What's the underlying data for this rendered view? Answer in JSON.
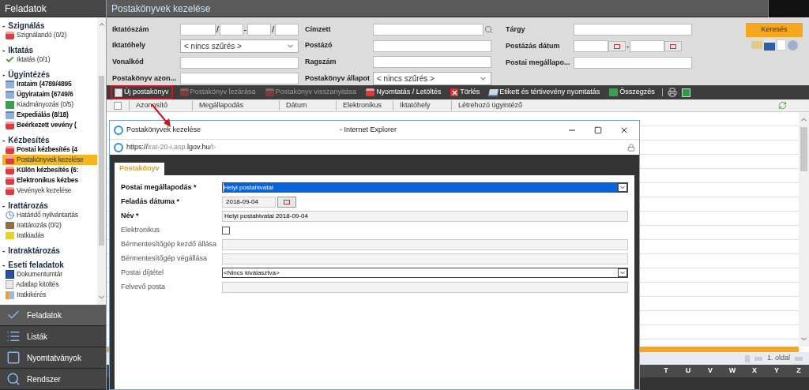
{
  "sidebar": {
    "title": "Feladatok",
    "sections": [
      {
        "toggle": "-",
        "title": "Szignálás",
        "items": [
          {
            "label": "Szignálandó (0/2)",
            "kind": "red",
            "bold": false,
            "selected": false
          }
        ]
      },
      {
        "toggle": "-",
        "title": "Iktatás",
        "items": [
          {
            "label": "Iktatás (0/1)",
            "kind": "check",
            "bold": false,
            "selected": false
          }
        ]
      },
      {
        "toggle": "-",
        "title": "Ügyintézés",
        "items": [
          {
            "label": "Irataim (4789/4895",
            "kind": "blue",
            "bold": true,
            "selected": false
          },
          {
            "label": "Ügyirataim (6749/6",
            "kind": "blue",
            "bold": true,
            "selected": false
          },
          {
            "label": "Kiadmányozás (0/5)",
            "kind": "green",
            "bold": false,
            "selected": false
          },
          {
            "label": "Expediálás (8/18)",
            "kind": "blue",
            "bold": true,
            "selected": false
          },
          {
            "label": "Beérkezett vevény (",
            "kind": "red",
            "bold": true,
            "selected": false
          }
        ]
      },
      {
        "toggle": "-",
        "title": "Kézbesítés",
        "items": [
          {
            "label": "Postai kézbesítés (4",
            "kind": "red",
            "bold": true,
            "selected": false
          },
          {
            "label": "Postakönyvek kezelése",
            "kind": "red",
            "bold": false,
            "selected": true
          },
          {
            "label": "Külön kézbesítés (6:",
            "kind": "red",
            "bold": true,
            "selected": false
          },
          {
            "label": "Elektronikus kézbes",
            "kind": "red",
            "bold": true,
            "selected": false
          },
          {
            "label": "Vevények kezelése",
            "kind": "red",
            "bold": false,
            "selected": false
          }
        ]
      },
      {
        "toggle": "-",
        "title": "Irattározás",
        "items": [
          {
            "label": "Határidő nyilvántartás",
            "kind": "clock",
            "bold": false,
            "selected": false
          },
          {
            "label": "Irattározás (0/2)",
            "kind": "brown",
            "bold": false,
            "selected": false
          },
          {
            "label": "Iratkiadás",
            "kind": "yellow",
            "bold": false,
            "selected": false
          }
        ]
      },
      {
        "toggle": "-",
        "title": "Iratraktározás"
      },
      {
        "toggle": "-",
        "title": "Eseti feladatok",
        "items": [
          {
            "label": "Dokumentumtár",
            "kind": "word",
            "bold": false,
            "selected": false
          },
          {
            "label": "Adatlap kitöltés",
            "kind": "doc",
            "bold": false,
            "selected": false
          },
          {
            "label": "Iratkikérés",
            "kind": "arrow",
            "bold": false,
            "selected": false
          }
        ]
      }
    ],
    "nav": [
      {
        "label": "Feladatok",
        "kind": "check",
        "selected": true
      },
      {
        "label": "Listák",
        "kind": "list",
        "selected": false
      },
      {
        "label": "Nyomtatványok",
        "kind": "form",
        "selected": false
      },
      {
        "label": "Rendszer",
        "kind": "search",
        "selected": false
      }
    ]
  },
  "header": {
    "title": "Postakönyvek kezelése"
  },
  "filters": [
    [
      {
        "label": "Iktatószám",
        "kind": "number",
        "separators": [
          "/",
          "-",
          "/"
        ]
      },
      {
        "label": "Iktatóhely",
        "kind": "select",
        "value": "< nincs szűrés >"
      },
      {
        "label": "Vonalkód",
        "kind": "text"
      },
      {
        "label": "Postakönyv azon...",
        "kind": "text"
      }
    ],
    [
      {
        "label": "Címzett",
        "kind": "lookup"
      },
      {
        "label": "Postázó",
        "kind": "text"
      },
      {
        "label": "Ragszám",
        "kind": "text"
      },
      {
        "label": "Postakönyv állapot",
        "kind": "select",
        "value": "< nincs szűrés >"
      }
    ],
    [
      {
        "label": "Tárgy",
        "kind": "text"
      },
      {
        "label": "Postázás dátum",
        "kind": "daterange",
        "separator": "-"
      },
      {
        "label": "Postai megállapo...",
        "kind": "text"
      }
    ]
  ],
  "search_button": "Keresés",
  "toolbar": [
    {
      "label": "Új postakönyv",
      "kind": "doc",
      "disabled": false,
      "highlighted": true
    },
    {
      "label": "Postakönyv lezárása",
      "kind": "red",
      "disabled": true,
      "highlighted": false
    },
    {
      "label": "Postakönyv visszanyitása",
      "kind": "red",
      "disabled": true,
      "highlighted": false
    },
    {
      "label": "Nyomtatás / Letöltés",
      "kind": "red",
      "disabled": false,
      "highlighted": false
    },
    {
      "label": "Törlés",
      "kind": "delete",
      "disabled": false,
      "highlighted": false
    },
    {
      "label": "Etikett és tértivevény nyomtatás",
      "kind": "label",
      "disabled": false,
      "highlighted": false
    },
    {
      "label": "Összegzés",
      "kind": "green",
      "disabled": false,
      "highlighted": false
    }
  ],
  "table": {
    "select_all_checked": false,
    "columns": [
      "Azonosító",
      "Megállapodás",
      "Dátum",
      "Elektronikus",
      "Iktatóhely",
      "Létrehozó ügyintéző"
    ],
    "page": "1. oldal",
    "letters": [
      "T",
      "U",
      "V",
      "W",
      "X",
      "Y",
      "Z"
    ]
  },
  "popup": {
    "title": "Postakönyvek kezelése",
    "app": "- Internet Explorer",
    "url": [
      {
        "text": "https://",
        "strong": true
      },
      {
        "text": "irat-20-i.asp.",
        "strong": false
      },
      {
        "text": "lgov.hu",
        "strong": true
      },
      {
        "text": "/t-",
        "strong": false
      }
    ],
    "tabs": [
      {
        "label": "Postakönyv",
        "selected": true
      }
    ],
    "fields": [
      {
        "label": "Postai megállapodás *",
        "required": true,
        "kind": "select",
        "value": "Helyi postahivatal",
        "highlighted": true
      },
      {
        "label": "Feladás dátuma *",
        "required": true,
        "kind": "date",
        "value": "2018-09-04"
      },
      {
        "label": "Név *",
        "required": true,
        "kind": "text",
        "value": "Helyi postahivatal 2018-09-04"
      },
      {
        "label": "Elektronikus",
        "required": false,
        "kind": "checkbox",
        "checked": false
      },
      {
        "label": "Bérmentesítőgép kezdő állása",
        "required": false,
        "kind": "text"
      },
      {
        "label": "Bérmentesítőgép végállása",
        "required": false,
        "kind": "text"
      },
      {
        "label": "Postai díjtétel",
        "required": false,
        "kind": "select",
        "value": "<Nincs kiválasztva>",
        "highlighted": false
      },
      {
        "label": "Felvevő posta",
        "required": false,
        "kind": "text"
      }
    ]
  }
}
